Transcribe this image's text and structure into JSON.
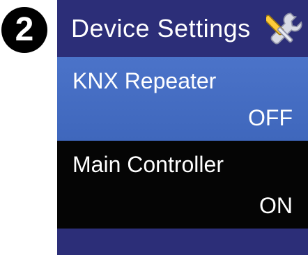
{
  "step": {
    "number": "2"
  },
  "screen": {
    "header": {
      "title": "Device Settings",
      "icon": "wrench-screwdriver-icon"
    },
    "items": [
      {
        "label": "KNX Repeater",
        "value": "OFF",
        "selected": true
      },
      {
        "label": "Main Controller",
        "value": "ON",
        "selected": false
      }
    ]
  },
  "colors": {
    "header_bg": "#2c2e78",
    "selected_row_bg": "#4a72c6",
    "row_bg": "#050505",
    "text": "#ffffff"
  }
}
